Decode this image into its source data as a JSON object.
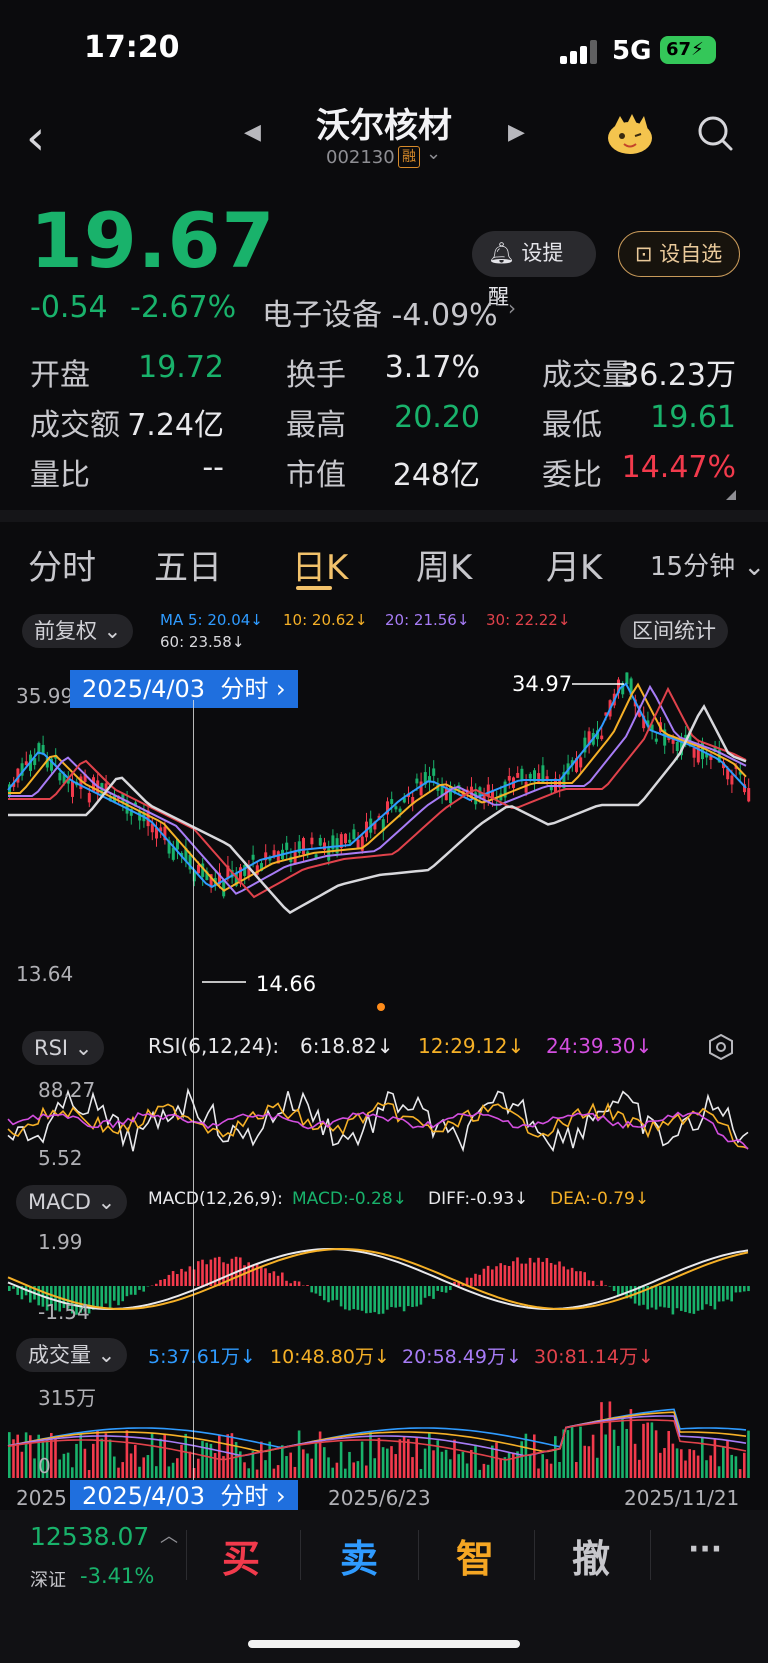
{
  "status": {
    "time": "17:20",
    "network": "5G",
    "battery": "67"
  },
  "header": {
    "name": "沃尔核材",
    "code": "002130",
    "margin_tag": "融"
  },
  "quote": {
    "price": "19.67",
    "change": "-0.54",
    "change_pct": "-2.67%",
    "sector": "电子设备",
    "sector_change": "-4.09%",
    "alert_label": "设提醒",
    "watch_label": "设自选"
  },
  "stats": [
    {
      "label": "开盘",
      "value": "19.72"
    },
    {
      "label": "换手",
      "value": "3.17%"
    },
    {
      "label": "成交量",
      "value": "36.23万"
    },
    {
      "label": "成交额",
      "value": "7.24亿"
    },
    {
      "label": "最高",
      "value": "20.20"
    },
    {
      "label": "最低",
      "value": "19.61"
    },
    {
      "label": "量比",
      "value": "--"
    },
    {
      "label": "市值",
      "value": "248亿"
    },
    {
      "label": "委比",
      "value": "14.47%"
    }
  ],
  "tabs": [
    "分时",
    "五日",
    "日K",
    "周K",
    "月K",
    "15分钟"
  ],
  "active_tab": "日K",
  "kline": {
    "adjust_label": "前复权",
    "range_stats_label": "区间统计",
    "ma": [
      {
        "label": "MA 5: 20.04↓",
        "color": "#2f9bff"
      },
      {
        "label": "10: 20.62↓",
        "color": "#f5b027"
      },
      {
        "label": "20: 21.56↓",
        "color": "#a77cf6"
      },
      {
        "label": "30: 22.22↓",
        "color": "#e0424b"
      },
      {
        "label": "60: 23.58↓",
        "color": "#d8d8dc"
      }
    ],
    "y_high": "35.99",
    "y_low": "13.64",
    "peak_label": "34.97",
    "trough_label": "14.66",
    "crosshair_date": "2025/4/03",
    "crosshair_suffix": "分时",
    "dates": [
      "2025",
      "2025/6/23",
      "2025/11/21"
    ]
  },
  "rsi": {
    "name": "RSI",
    "params": "RSI(6,12,24):",
    "v6": "6:18.82↓",
    "v12": "12:29.12↓",
    "v24": "24:39.30↓",
    "y_high": "88.27",
    "y_low": "5.52"
  },
  "macd": {
    "name": "MACD",
    "params": "MACD(12,26,9):",
    "macd": "MACD:-0.28↓",
    "diff": "DIFF:-0.93↓",
    "dea": "DEA:-0.79↓",
    "y_high": "1.99",
    "y_low": "-1.54"
  },
  "volume": {
    "name": "成交量",
    "ma5": "5:37.61万↓",
    "ma10": "10:48.80万↓",
    "ma20": "20:58.49万↓",
    "ma30": "30:81.14万↓",
    "y_high": "315万",
    "y_low": "0"
  },
  "bottom": {
    "index_value": "12538.07",
    "index_name": "深证",
    "index_change": "-3.41%",
    "buy": "买",
    "sell": "卖",
    "smart": "智",
    "cancel": "撤",
    "more": "···"
  },
  "colors": {
    "up": "#f23a4c",
    "down": "#19b26b",
    "accent": "#f2c26b",
    "badge": "#1f6fde"
  }
}
